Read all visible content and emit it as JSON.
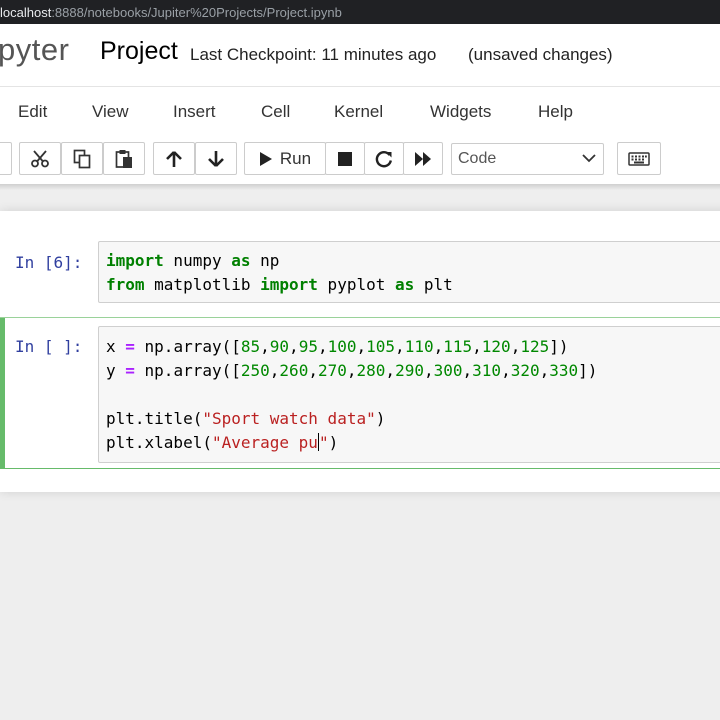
{
  "browser": {
    "url_host": "localhost",
    "url_path": ":8888/notebooks/Jupiter%20Projects/Project.ipynb"
  },
  "header": {
    "logo": "pyter",
    "notebook_name": "Project",
    "checkpoint": "Last Checkpoint: 11 minutes ago",
    "save_status": "(unsaved changes)"
  },
  "menu": {
    "edit": "Edit",
    "view": "View",
    "insert": "Insert",
    "cell": "Cell",
    "kernel": "Kernel",
    "widgets": "Widgets",
    "help": "Help"
  },
  "toolbar": {
    "run_label": "Run",
    "cell_type": "Code",
    "icons": [
      "cut-icon",
      "copy-icon",
      "paste-icon",
      "arrow-up-icon",
      "arrow-down-icon",
      "play-icon",
      "stop-icon",
      "restart-icon",
      "fast-forward-icon",
      "chevron-down-icon",
      "keyboard-icon"
    ]
  },
  "cells": [
    {
      "prompt": "In [6]:",
      "lines": [
        {
          "t1": "import",
          "t2": " numpy ",
          "t3": "as",
          "t4": " np"
        },
        {
          "t1": "from",
          "t2": " matplotlib ",
          "t3": "import",
          "t4": " pyplot ",
          "t5": "as",
          "t6": " plt"
        }
      ]
    },
    {
      "prompt": "In [ ]:",
      "x_line": {
        "var": "x ",
        "eq": "=",
        "call": " np.array([",
        "nums": [
          "85",
          "90",
          "95",
          "100",
          "105",
          "110",
          "115",
          "120",
          "125"
        ],
        "close": "])"
      },
      "y_line": {
        "var": "y ",
        "eq": "=",
        "call": " np.array([",
        "nums": [
          "250",
          "260",
          "270",
          "280",
          "290",
          "300",
          "310",
          "320",
          "330"
        ],
        "close": "])"
      },
      "title_line": {
        "call": "plt.title(",
        "str": "\"Sport watch data\"",
        "close": ")"
      },
      "xlabel_line": {
        "call": "plt.xlabel(",
        "str": "\"Average pu",
        "str_end": "\"",
        "close": ")"
      }
    }
  ],
  "colors": {
    "keyword": "#008000",
    "number": "#008800",
    "operator": "#aa22ff",
    "string": "#ba2121",
    "prompt": "#303f9f",
    "edit_mode": "#66bb6a"
  }
}
